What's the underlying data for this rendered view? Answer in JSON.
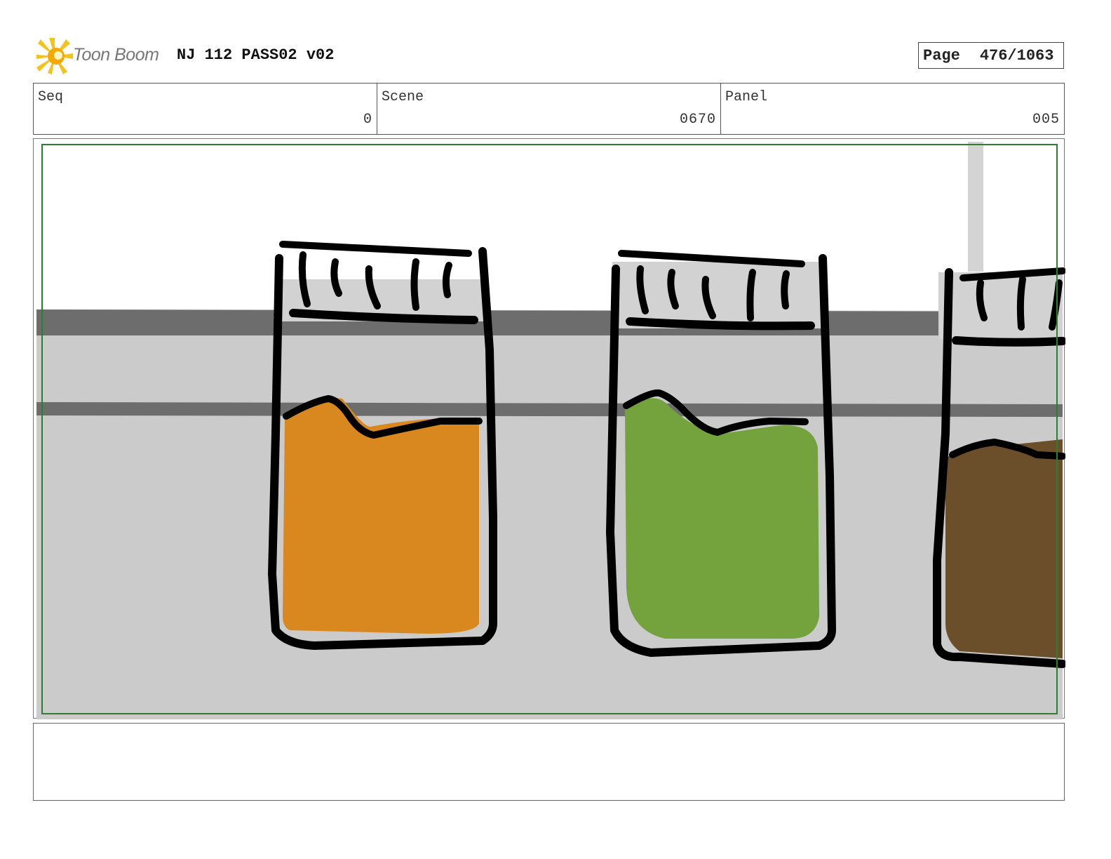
{
  "header": {
    "logo_text": "Toon Boom",
    "title": "NJ 112 PASS02 v02",
    "page_label": "Page",
    "page_value": "476/1063"
  },
  "info": {
    "seq_label": "Seq",
    "seq_value": "0",
    "scene_label": "Scene",
    "scene_value": "0670",
    "panel_label": "Panel",
    "panel_value": "005"
  },
  "colors": {
    "frame_green": "#2e7d32",
    "orange_liquid": "#d98820",
    "green_liquid": "#74a23d",
    "brown_liquid": "#6b4e2a",
    "shelf_gray": "#cbcbcb"
  },
  "notes": {
    "text": ""
  }
}
